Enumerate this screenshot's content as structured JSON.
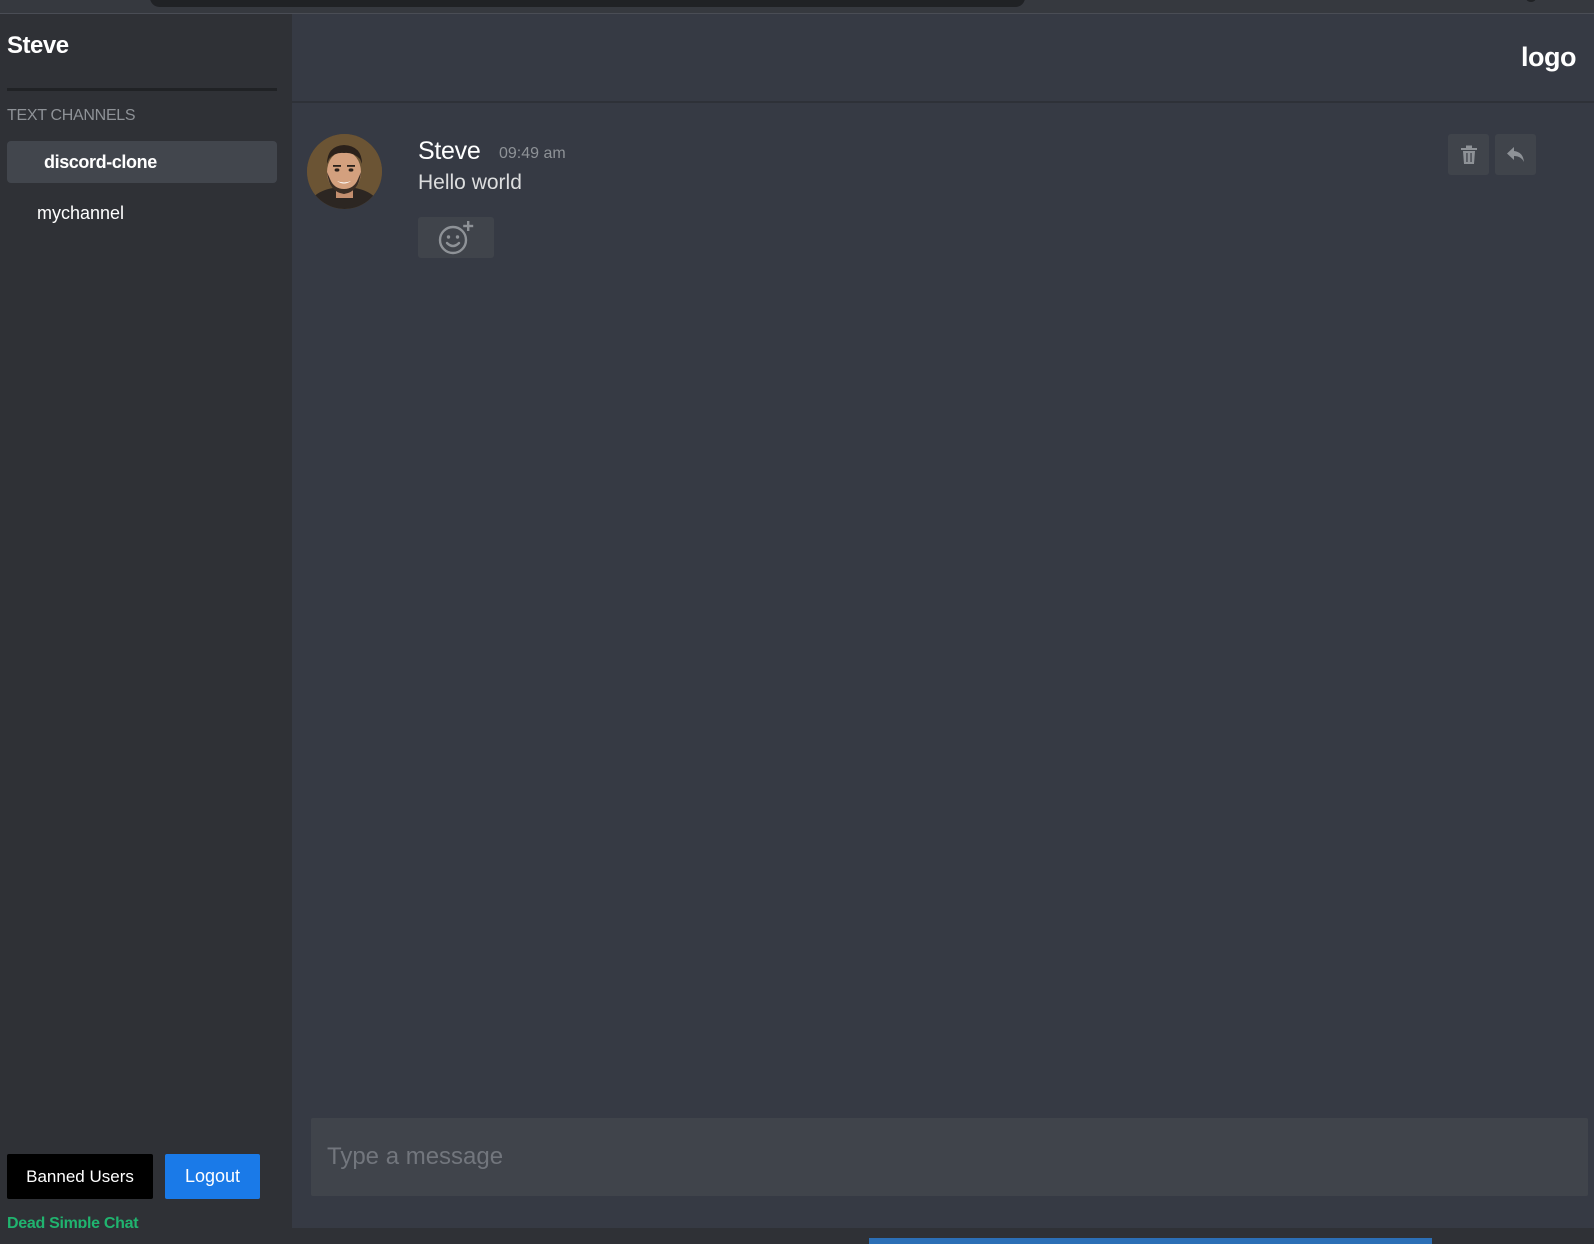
{
  "sidebar": {
    "username": "Steve",
    "section_label": "TEXT CHANNELS",
    "channels": [
      {
        "label": "discord-clone",
        "active": true
      },
      {
        "label": "mychannel",
        "active": false
      }
    ],
    "banned_users_label": "Banned Users",
    "logout_label": "Logout",
    "brand_label": "Dead Simple Chat"
  },
  "header": {
    "logo_text": "logo"
  },
  "messages": [
    {
      "author": "Steve",
      "time": "09:49 am",
      "text": "Hello world"
    }
  ],
  "composer": {
    "placeholder": "Type a message"
  },
  "icons": {
    "delete": "trash-icon",
    "reply": "reply-icon",
    "add_reaction": "add-emoji-icon"
  },
  "colors": {
    "sidebar_bg": "#2f3136",
    "main_bg": "#363a44",
    "active_channel_bg": "#42464d",
    "logout_button": "#1a7ae8",
    "brand_green": "#20b46f"
  }
}
